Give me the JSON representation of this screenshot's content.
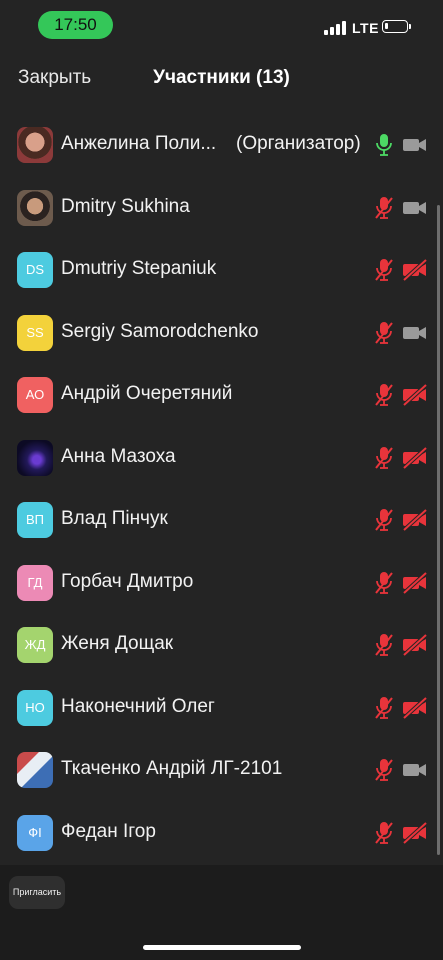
{
  "status": {
    "time": "17:50",
    "network": "LTE"
  },
  "nav": {
    "close_label": "Закрыть",
    "title": "Участники (13)"
  },
  "organizer_label": "(Организатор)",
  "colors": {
    "muted": "#e8343b",
    "active_mic": "#4cd964",
    "camera_on": "#9a9a9a"
  },
  "participants": [
    {
      "name": "Анжелина Поли...",
      "avatar": "photo",
      "mic": "on",
      "video": "on"
    },
    {
      "name": "Dmitry Sukhina",
      "avatar": "photo",
      "mic": "muted",
      "video": "on"
    },
    {
      "name": "Dmutriy Stepaniuk",
      "initials": "DS",
      "color": "#4dcbe0",
      "mic": "muted",
      "video": "off"
    },
    {
      "name": "Sergiy Samorodchenko",
      "initials": "SS",
      "color": "#f3d23b",
      "mic": "muted",
      "video": "on"
    },
    {
      "name": "Андрій Очеретяний",
      "initials": "АО",
      "color": "#f06161",
      "mic": "muted",
      "video": "off"
    },
    {
      "name": "Анна Мазоха",
      "avatar": "photo",
      "mic": "muted",
      "video": "off"
    },
    {
      "name": "Влад Пінчук",
      "initials": "ВП",
      "color": "#4dcbe0",
      "mic": "muted",
      "video": "off"
    },
    {
      "name": "Горбач Дмитро",
      "initials": "ГД",
      "color": "#ec8ab5",
      "mic": "muted",
      "video": "off"
    },
    {
      "name": "Женя Дощак",
      "initials": "ЖД",
      "color": "#a4d46e",
      "mic": "muted",
      "video": "off"
    },
    {
      "name": "Наконечний Олег",
      "initials": "НО",
      "color": "#4dcbe0",
      "mic": "muted",
      "video": "off"
    },
    {
      "name": "Ткаченко Андрій ЛГ-2101",
      "avatar": "photo",
      "mic": "muted",
      "video": "on"
    },
    {
      "name": "Федан Ігор",
      "initials": "ФІ",
      "color": "#5aa4e8",
      "mic": "muted",
      "video": "off"
    }
  ],
  "footer": {
    "invite_label": "Пригласить"
  }
}
